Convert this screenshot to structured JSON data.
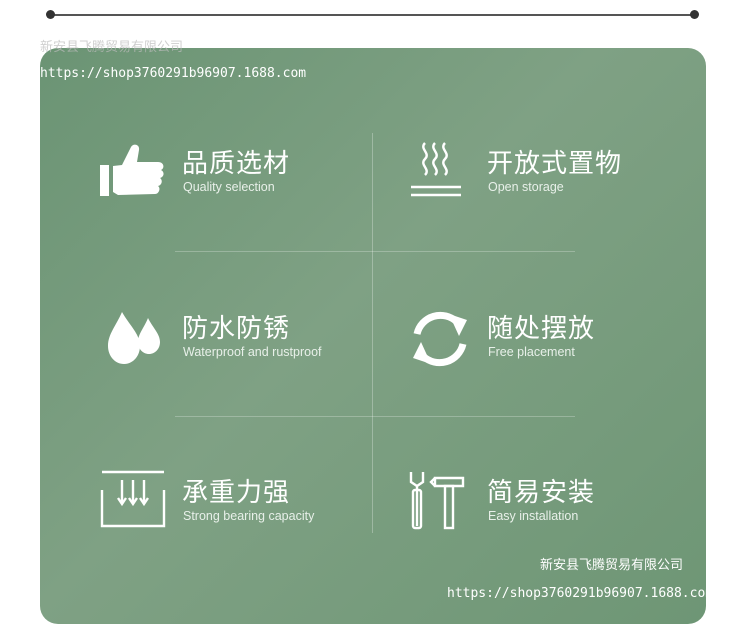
{
  "watermark": {
    "company": "新安县飞腾贸易有限公司",
    "url": "https://shop3760291b96907.1688.com"
  },
  "features": [
    {
      "icon": "thumbs-up-icon",
      "title": "品质选材",
      "subtitle": "Quality selection"
    },
    {
      "icon": "heat-waves-icon",
      "title": "开放式置物",
      "subtitle": "Open storage"
    },
    {
      "icon": "water-drops-icon",
      "title": "防水防锈",
      "subtitle": "Waterproof and rustproof"
    },
    {
      "icon": "refresh-arrows-icon",
      "title": "随处摆放",
      "subtitle": "Free placement"
    },
    {
      "icon": "load-bearing-icon",
      "title": "承重力强",
      "subtitle": "Strong bearing capacity"
    },
    {
      "icon": "tools-icon",
      "title": "简易安装",
      "subtitle": "Easy installation"
    }
  ],
  "colors": {
    "panel_bg": "#7a9d80",
    "text": "#ffffff"
  }
}
